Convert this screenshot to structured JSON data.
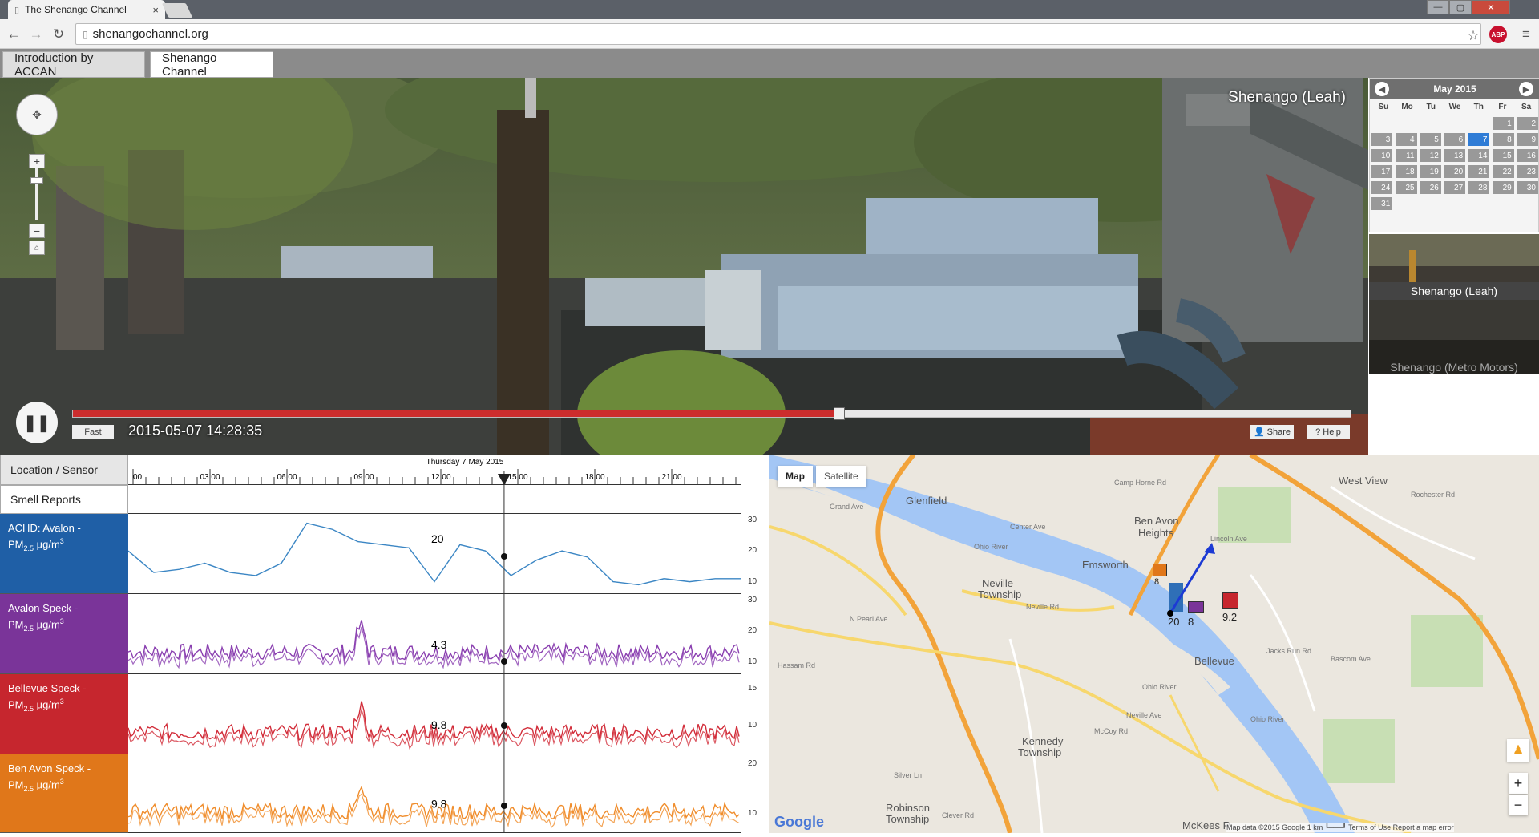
{
  "browser": {
    "tab_title": "The Shenango Channel",
    "tab_close": "×",
    "url": "shenangochannel.org",
    "window_controls": [
      "—",
      "▢",
      "✕"
    ]
  },
  "page_tabs": [
    {
      "label": "Introduction by ACCAN",
      "active": false
    },
    {
      "label": "Shenango Channel",
      "active": true
    }
  ],
  "video": {
    "camera_label": "Shenango (Leah)",
    "timestamp": "2015-05-07 14:28:35",
    "speed_label": "Fast",
    "share_label": "Share",
    "help_label": "Help",
    "progress": 0.6
  },
  "calendar": {
    "month": "May 2015",
    "days": [
      "Su",
      "Mo",
      "Tu",
      "We",
      "Th",
      "Fr",
      "Sa"
    ],
    "first_weekday": 5,
    "count": 31,
    "selected": 7
  },
  "cameras": [
    {
      "label": "Shenango (Leah)",
      "active": true
    },
    {
      "label": "Shenango (Metro Motors)",
      "active": false
    }
  ],
  "sensors": {
    "header_location": "Location / Sensor",
    "date_label": "Thursday 7 May 2015",
    "time_ticks": [
      "00",
      "03:00",
      "06:00",
      "09:00",
      "12:00",
      "15:00",
      "18:00",
      "21:00"
    ],
    "smell_reports": "Smell Reports",
    "rows": [
      {
        "title": "ACHD: Avalon -",
        "color": "#1f5fa6",
        "line": "#3b86c4",
        "value": "20",
        "yticks": [
          "30",
          "20",
          "10"
        ],
        "ymax": 32,
        "ymin": 6
      },
      {
        "title": "Avalon Speck -",
        "color": "#7a3499",
        "line": "#8a3fb0",
        "value": "4.3",
        "yticks": [
          "30",
          "20",
          "10"
        ],
        "ymax": 32,
        "ymin": 6
      },
      {
        "title": "Bellevue Speck -",
        "color": "#c6262e",
        "line": "#d22d3a",
        "value": "9.8",
        "yticks": [
          "15",
          "10"
        ],
        "ymax": 17,
        "ymin": 6
      },
      {
        "title": "Ben Avon Speck -",
        "color": "#e0771a",
        "line": "#f08d2c",
        "value": "9.8",
        "yticks": [
          "20",
          "10"
        ],
        "ymax": 22,
        "ymin": 6
      }
    ],
    "unit_prefix": "PM",
    "unit_sub": "2.5",
    "unit_rest": " µg/m",
    "unit_sup": "3"
  },
  "chart_data": {
    "type": "line",
    "title": "Thursday 7 May 2015",
    "x_ticks": [
      "00",
      "03:00",
      "06:00",
      "09:00",
      "12:00",
      "15:00",
      "18:00",
      "21:00"
    ],
    "series": [
      {
        "name": "ACHD: Avalon - PM2.5 µg/m3",
        "x_hours": [
          0,
          1,
          2,
          3,
          4,
          5,
          6,
          7,
          8,
          9,
          10,
          11,
          12,
          13,
          14,
          15,
          16,
          17,
          18,
          19,
          20,
          21,
          22,
          23,
          24
        ],
        "values": [
          20,
          13,
          14,
          16,
          13,
          12,
          16,
          29,
          27,
          23,
          22,
          21,
          10,
          22,
          20,
          12,
          17,
          20,
          18,
          10,
          9,
          11,
          10,
          11,
          11
        ]
      },
      {
        "name": "Avalon Speck - PM2.5 µg/m3",
        "value_at_cursor": 4.3
      },
      {
        "name": "Bellevue Speck - PM2.5 µg/m3",
        "value_at_cursor": 9.8
      },
      {
        "name": "Ben Avon Speck - PM2.5 µg/m3",
        "value_at_cursor": 9.8
      }
    ],
    "cursor_time": "14:28"
  },
  "map": {
    "type_buttons": [
      "Map",
      "Satellite"
    ],
    "places": [
      {
        "t": "Glenfield",
        "x": 170,
        "y": 50
      },
      {
        "t": "Ben Avon",
        "x": 455,
        "y": 75
      },
      {
        "t": "Heights",
        "x": 460,
        "y": 90
      },
      {
        "t": "Emsworth",
        "x": 390,
        "y": 130
      },
      {
        "t": "Neville",
        "x": 265,
        "y": 153
      },
      {
        "t": "Township",
        "x": 260,
        "y": 167
      },
      {
        "t": "Bellevue",
        "x": 530,
        "y": 250
      },
      {
        "t": "Kennedy",
        "x": 315,
        "y": 350
      },
      {
        "t": "Township",
        "x": 310,
        "y": 364
      },
      {
        "t": "West View",
        "x": 710,
        "y": 25
      },
      {
        "t": "Robinson",
        "x": 145,
        "y": 433
      },
      {
        "t": "Township",
        "x": 145,
        "y": 447
      },
      {
        "t": "McKees R",
        "x": 515,
        "y": 455
      }
    ],
    "roads": [
      {
        "t": "Grand Ave",
        "x": 75,
        "y": 60
      },
      {
        "t": "Ohio River",
        "x": 255,
        "y": 110
      },
      {
        "t": "Ohio River",
        "x": 465,
        "y": 285
      },
      {
        "t": "Ohio River",
        "x": 600,
        "y": 325
      },
      {
        "t": "Neville Rd",
        "x": 320,
        "y": 185
      },
      {
        "t": "Center Ave",
        "x": 300,
        "y": 85
      },
      {
        "t": "Camp Horne Rd",
        "x": 430,
        "y": 30
      },
      {
        "t": "Rochester Rd",
        "x": 800,
        "y": 45
      },
      {
        "t": "Lincoln Ave",
        "x": 550,
        "y": 100
      },
      {
        "t": "Jacks Run Rd",
        "x": 620,
        "y": 240
      },
      {
        "t": "Bascom Ave",
        "x": 700,
        "y": 250
      },
      {
        "t": "N Pearl Ave",
        "x": 100,
        "y": 200
      },
      {
        "t": "Hassam Rd",
        "x": 10,
        "y": 258
      },
      {
        "t": "Neville Ave",
        "x": 445,
        "y": 320
      },
      {
        "t": "McCoy Rd",
        "x": 405,
        "y": 340
      },
      {
        "t": "Silver Ln",
        "x": 155,
        "y": 395
      },
      {
        "t": "Clever Rd",
        "x": 215,
        "y": 445
      }
    ],
    "sensor_values": [
      {
        "v": "20",
        "color": "#2f6fb7"
      },
      {
        "v": "8",
        "color": "#7a3499"
      },
      {
        "v": "9.2",
        "color": "#c6262e"
      },
      {
        "v": "8",
        "color": "#e0771a"
      }
    ],
    "footer": "Map data ©2015 Google   1 km ┗━━━┛   Terms of Use   Report a map error",
    "google": "Google",
    "zoom_in": "+",
    "zoom_out": "−"
  }
}
